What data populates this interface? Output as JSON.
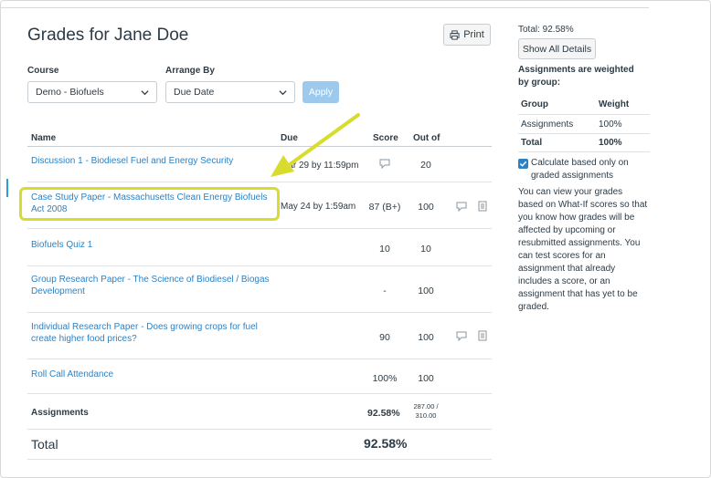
{
  "page": {
    "title": "Grades for Jane Doe",
    "print_label": "Print"
  },
  "filters": {
    "course_label": "Course",
    "course_value": "Demo - Biofuels",
    "arrange_label": "Arrange By",
    "arrange_value": "Due Date",
    "apply_label": "Apply"
  },
  "table": {
    "headers": {
      "name": "Name",
      "due": "Due",
      "score": "Score",
      "outof": "Out of"
    },
    "rows": [
      {
        "name": "Discussion 1 - Biodiesel Fuel and Energy Security",
        "due": "Mar 29 by 11:59pm",
        "score": "",
        "outof": "20",
        "score_icon": "comment-icon"
      },
      {
        "name": "Case Study Paper - Massachusetts Clean Energy Biofuels Act 2008",
        "due": "May 24 by 1:59am",
        "score": "87 (B+)",
        "outof": "100",
        "icons": [
          "comment-icon",
          "rubric-icon"
        ]
      },
      {
        "name": "Biofuels Quiz 1",
        "due": "",
        "score": "10",
        "outof": "10"
      },
      {
        "name": "Group Research Paper - The Science of Biodiesel / Biogas Development",
        "due": "",
        "score": "-",
        "outof": "100"
      },
      {
        "name": "Individual Research Paper - Does growing crops for fuel create higher food prices?",
        "due": "",
        "score": "90",
        "outof": "100",
        "icons": [
          "comment-icon",
          "rubric-icon"
        ]
      },
      {
        "name": "Roll Call Attendance",
        "due": "",
        "score": "100%",
        "outof": "100"
      }
    ],
    "group_row": {
      "name": "Assignments",
      "score": "92.58%",
      "outof_line1": "287.00 /",
      "outof_line2": "310.00"
    },
    "total_row": {
      "name": "Total",
      "score": "92.58%"
    }
  },
  "sidebar": {
    "total": "Total: 92.58%",
    "show_all": "Show All Details",
    "weighted_note": "Assignments are weighted by group:",
    "weights": {
      "headers": [
        "Group",
        "Weight"
      ],
      "rows": [
        {
          "group": "Assignments",
          "weight": "100%"
        },
        {
          "group": "Total",
          "weight": "100%"
        }
      ]
    },
    "calc_label": "Calculate based only on graded assignments",
    "whatif_text": "You can view your grades based on What-If scores so that you know how grades will be affected by upcoming or resubmitted assignments. You can test scores for an assignment that already includes a score, or an assignment that has yet to be graded."
  },
  "colors": {
    "link": "#2d82c4",
    "highlight": "#d8dc2f",
    "apply": "#9cc9ec"
  }
}
